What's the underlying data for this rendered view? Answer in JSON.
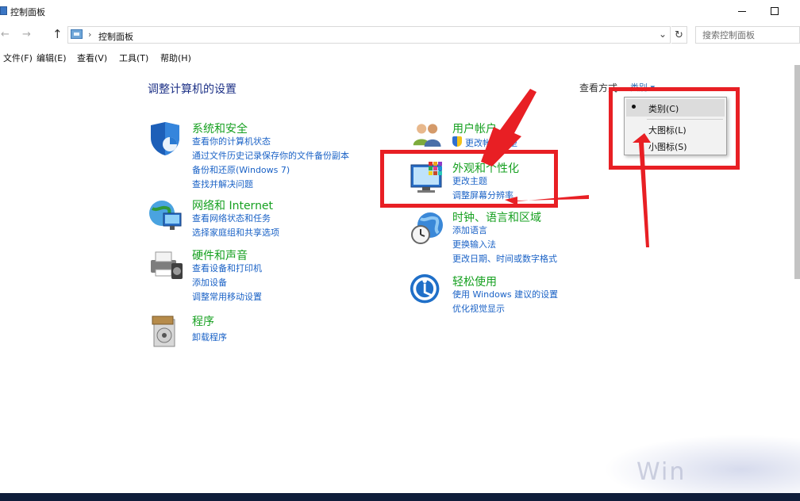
{
  "window": {
    "title": "控制面板"
  },
  "address": {
    "path": "控制面板",
    "search_placeholder": "搜索控制面板"
  },
  "menu": [
    "文件(F)",
    "编辑(E)",
    "查看(V)",
    "工具(T)",
    "帮助(H)"
  ],
  "content": {
    "heading": "调整计算机的设置",
    "view_by_label": "查看方式",
    "view_by_value": "类别 ▾"
  },
  "categories": [
    {
      "title": "系统和安全",
      "icon": "shield-icon",
      "links": [
        "查看你的计算机状态",
        "通过文件历史记录保存你的文件备份副本",
        "备份和还原(Windows 7)",
        "查找并解决问题"
      ]
    },
    {
      "title": "网络和 Internet",
      "icon": "network-globe-icon",
      "links": [
        "查看网络状态和任务",
        "选择家庭组和共享选项"
      ]
    },
    {
      "title": "硬件和声音",
      "icon": "printer-icon",
      "links": [
        "查看设备和打印机",
        "添加设备",
        "调整常用移动设置"
      ]
    },
    {
      "title": "程序",
      "icon": "programs-icon",
      "links": [
        "卸载程序"
      ]
    },
    {
      "title": "用户帐户",
      "icon": "users-icon",
      "links": [
        "更改帐户类型"
      ]
    },
    {
      "title": "外观和个性化",
      "icon": "appearance-monitor-icon",
      "links": [
        "更改主题",
        "调整屏幕分辨率"
      ]
    },
    {
      "title": "时钟、语言和区域",
      "icon": "clock-globe-icon",
      "links": [
        "添加语言",
        "更换输入法",
        "更改日期、时间或数字格式"
      ]
    },
    {
      "title": "轻松使用",
      "icon": "ease-of-access-icon",
      "links": [
        "使用 Windows 建议的设置",
        "优化视觉显示"
      ]
    }
  ],
  "dropdown": {
    "options": [
      "类别(C)",
      "大图标(L)",
      "小图标(S)"
    ],
    "selected": 0
  },
  "watermark": "Win"
}
